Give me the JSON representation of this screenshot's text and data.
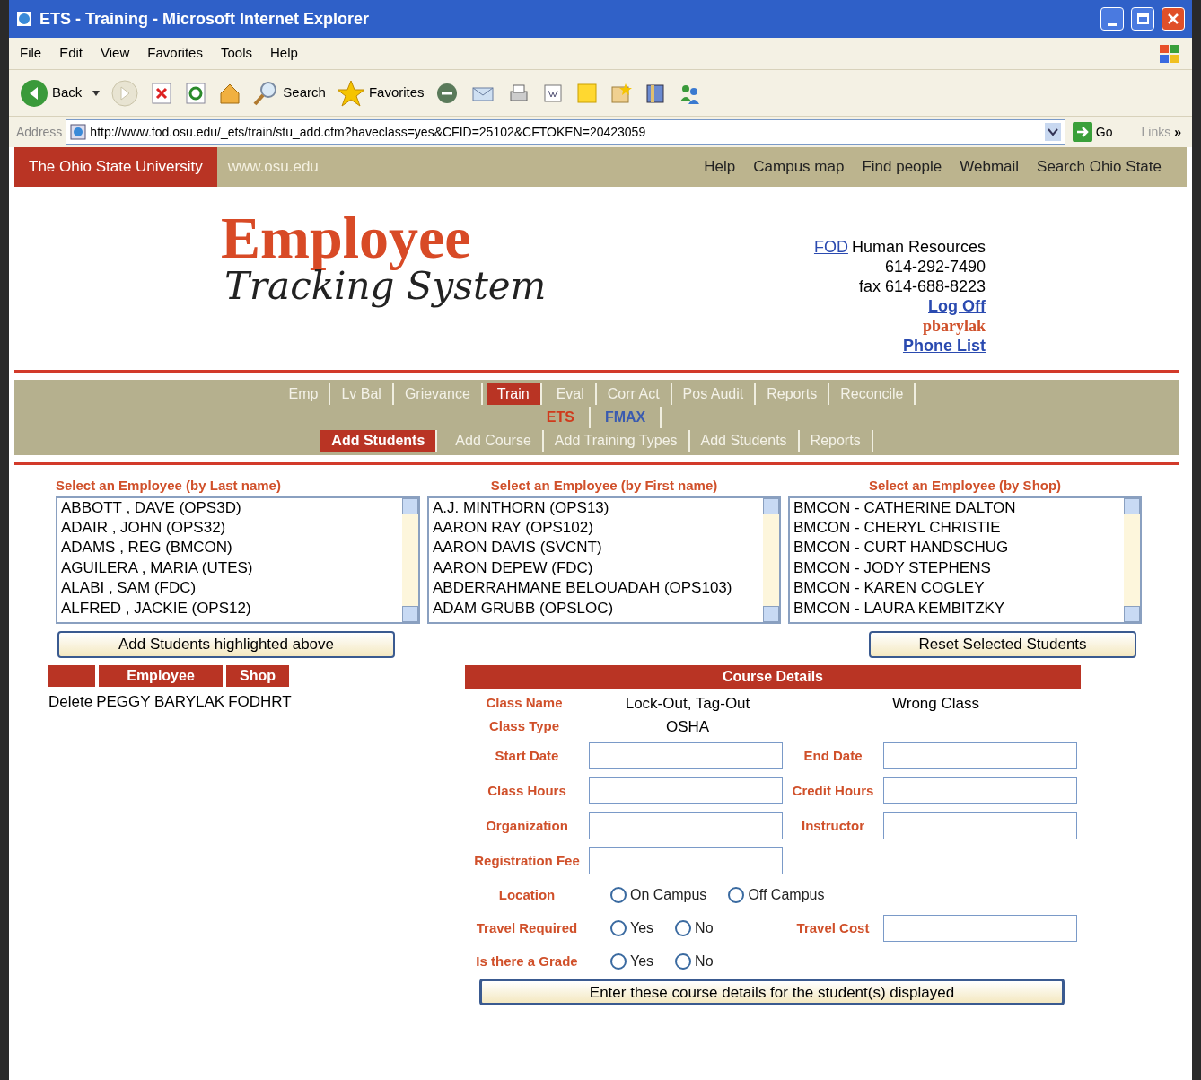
{
  "window": {
    "title": "ETS - Training - Microsoft Internet Explorer"
  },
  "menu_bar": [
    "File",
    "Edit",
    "View",
    "Favorites",
    "Tools",
    "Help"
  ],
  "toolbar": {
    "back": "Back",
    "search": "Search",
    "favorites": "Favorites"
  },
  "address_bar": {
    "label": "Address",
    "url": "http://www.fod.osu.edu/_ets/train/stu_add.cfm?haveclass=yes&CFID=25102&CFTOKEN=20423059",
    "go": "Go",
    "links": "Links",
    "more": "»"
  },
  "osu_bar": {
    "brand": "The Ohio State University",
    "site": "www.osu.edu",
    "links": [
      "Help",
      "Campus map",
      "Find people",
      "Webmail",
      "Search Ohio State"
    ]
  },
  "header": {
    "logo_title": "Employee",
    "logo_subtitle": "Tracking System",
    "org_link": "FOD",
    "org": "Human Resources",
    "phone": "614-292-7490",
    "fax": "fax 614-688-8223",
    "log_off": "Log Off",
    "user": "pbarylak",
    "phone_list": "Phone List"
  },
  "nav": {
    "tabs": [
      {
        "label": "Emp",
        "selected": false
      },
      {
        "label": "Lv Bal",
        "selected": false
      },
      {
        "label": "Grievance",
        "selected": false
      },
      {
        "label": "Train",
        "selected": true
      },
      {
        "label": "Eval",
        "selected": false
      },
      {
        "label": "Corr Act",
        "selected": false
      },
      {
        "label": "Pos Audit",
        "selected": false
      },
      {
        "label": "Reports",
        "selected": false
      },
      {
        "label": "Reconcile",
        "selected": false
      }
    ],
    "systems": [
      {
        "label": "ETS",
        "color": "#d03a1c"
      },
      {
        "label": "FMAX",
        "color": "#3a5bb0"
      }
    ],
    "subtabs": [
      {
        "label": "Add Students",
        "selected": true
      },
      {
        "label": "Add Course",
        "selected": false
      },
      {
        "label": "Add Training Types",
        "selected": false
      },
      {
        "label": "Add Students",
        "selected": false
      },
      {
        "label": "Reports",
        "selected": false
      }
    ]
  },
  "selectors": [
    {
      "title": "Select an Employee (by Last name)",
      "options": [
        "ABBOTT , DAVE (OPS3D)",
        "ADAIR , JOHN (OPS32)",
        "ADAMS , REG (BMCON)",
        "AGUILERA , MARIA (UTES)",
        "ALABI , SAM (FDC)",
        "ALFRED , JACKIE (OPS12)"
      ]
    },
    {
      "title": "Select an Employee (by First name)",
      "options": [
        "A.J. MINTHORN (OPS13)",
        "AARON RAY (OPS102)",
        "AARON DAVIS (SVCNT)",
        "AARON DEPEW (FDC)",
        "ABDERRAHMANE BELOUADAH (OPS103)",
        "ADAM GRUBB (OPSLOC)"
      ]
    },
    {
      "title": "Select an Employee (by Shop)",
      "options": [
        "BMCON - CATHERINE DALTON",
        "BMCON - CHERYL CHRISTIE",
        "BMCON - CURT HANDSCHUG",
        "BMCON - JODY STEPHENS",
        "BMCON - KAREN COGLEY",
        "BMCON - LAURA KEMBITZKY"
      ]
    }
  ],
  "add_button": "Add Students highlighted above",
  "reset_button": "Reset Selected Students",
  "students": {
    "columns": [
      "Employee",
      "Shop"
    ],
    "rows": [
      {
        "action": "Delete",
        "employee": "PEGGY BARYLAK",
        "shop": "FODHRT"
      }
    ]
  },
  "course_details": {
    "title": "Course Details",
    "class_name_label": "Class Name",
    "class_name": "Lock-Out, Tag-Out",
    "wrong_class": "Wrong Class",
    "class_type_label": "Class Type",
    "class_type": "OSHA",
    "rows": [
      {
        "kind": "fields",
        "items": [
          {
            "label": "Start Date"
          },
          {
            "label": "End Date"
          }
        ]
      },
      {
        "kind": "fields",
        "items": [
          {
            "label": "Class Hours"
          },
          {
            "label": "Credit Hours"
          }
        ]
      },
      {
        "kind": "fields",
        "items": [
          {
            "label": "Organization"
          },
          {
            "label": "Instructor"
          }
        ]
      },
      {
        "kind": "fields",
        "items": [
          {
            "label": "Registration Fee"
          }
        ]
      },
      {
        "kind": "radios",
        "label": "Location",
        "options": [
          {
            "label": "On Campus",
            "selected": false
          },
          {
            "label": "Off Campus",
            "selected": false
          }
        ]
      },
      {
        "kind": "radios",
        "label": "Travel Required",
        "options": [
          {
            "label": "Yes",
            "selected": false
          },
          {
            "label": "No",
            "selected": false
          }
        ],
        "field": {
          "label": "Travel Cost"
        }
      },
      {
        "kind": "radios",
        "label": "Is there a Grade",
        "options": [
          {
            "label": "Yes",
            "selected": false
          },
          {
            "label": "No",
            "selected": false
          }
        ]
      }
    ],
    "submit": "Enter these course details for the student(s) displayed"
  }
}
